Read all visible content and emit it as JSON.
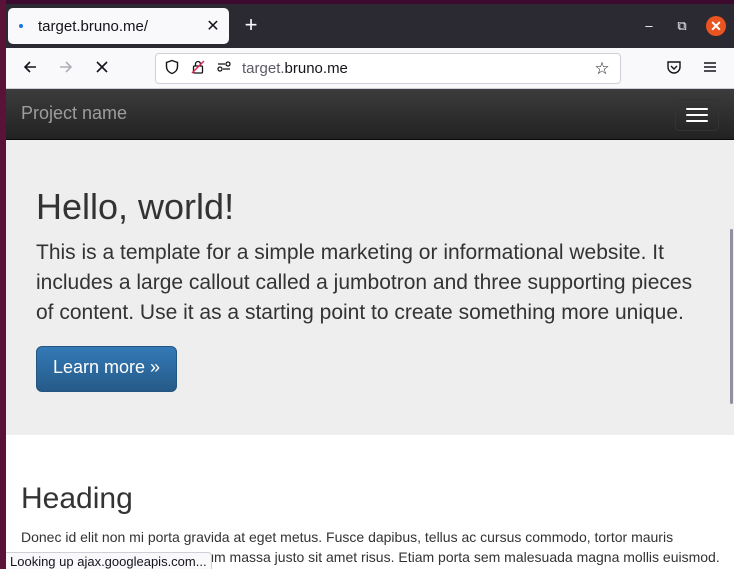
{
  "browser": {
    "tab": {
      "title": "target.bruno.me/",
      "close_icon": "close-icon"
    },
    "new_tab_label": "+",
    "window_controls": {
      "minimize": "–",
      "restore": "⧉",
      "close": "✕"
    },
    "url": {
      "dim_part": "target.",
      "main_part": "bruno.me"
    },
    "status_text": "Looking up ajax.googleapis.com..."
  },
  "page": {
    "navbar": {
      "brand": "Project name"
    },
    "jumbotron": {
      "heading": "Hello, world!",
      "text": "This is a template for a simple marketing or informational website. It includes a large callout called a jumbotron and three supporting pieces of content. Use it as a starting point to create something more unique.",
      "button_label": "Learn more »"
    },
    "section": {
      "heading": "Heading",
      "text": "Donec id elit non mi porta gravida at eget metus. Fusce dapibus, tellus ac cursus commodo, tortor mauris condimentum nibh, ut fermentum massa justo sit amet risus. Etiam porta sem malesuada magna mollis euismod."
    }
  },
  "colors": {
    "accent_button": "#337ab7",
    "navbar_bg": "#222222",
    "jumbotron_bg": "#eeeeee",
    "window_close": "#e95420"
  }
}
